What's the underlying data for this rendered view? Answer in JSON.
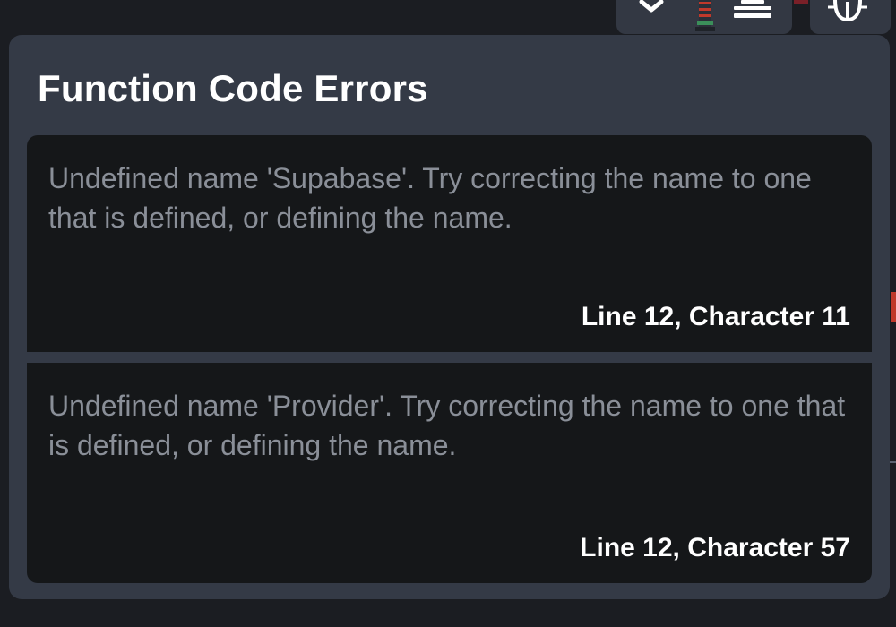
{
  "toolbar": {
    "icons": [
      "chevron-down-icon",
      "tower-icon",
      "align-icon",
      "bug-icon"
    ]
  },
  "errors_panel": {
    "title": "Function Code Errors",
    "errors": [
      {
        "message": "Undefined name 'Supabase'. Try correcting the name to one that is defined, or defining the name.",
        "location": "Line 12, Character 11"
      },
      {
        "message": "Undefined name 'Provider'. Try correcting the name to one that is defined, or defining the name.",
        "location": "Line 12, Character 57"
      }
    ]
  },
  "colors": {
    "page_background": "#1b1d22",
    "panel_background": "#343a46",
    "error_background": "#151719",
    "message_text": "#8a8f98",
    "title_text": "#ffffff"
  }
}
